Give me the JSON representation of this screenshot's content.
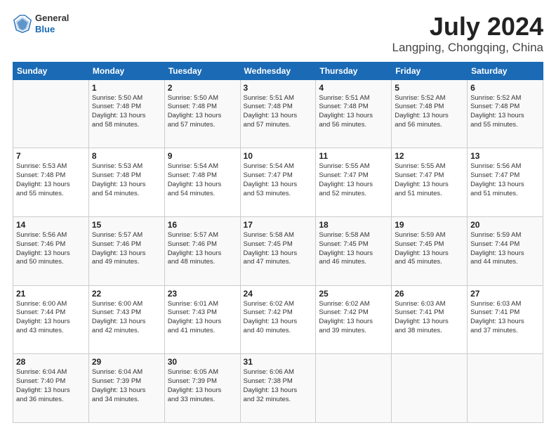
{
  "header": {
    "logo_line1": "General",
    "logo_line2": "Blue",
    "month": "July 2024",
    "location": "Langping, Chongqing, China"
  },
  "days_of_week": [
    "Sunday",
    "Monday",
    "Tuesday",
    "Wednesday",
    "Thursday",
    "Friday",
    "Saturday"
  ],
  "weeks": [
    [
      {
        "day": "",
        "content": ""
      },
      {
        "day": "1",
        "content": "Sunrise: 5:50 AM\nSunset: 7:48 PM\nDaylight: 13 hours\nand 58 minutes."
      },
      {
        "day": "2",
        "content": "Sunrise: 5:50 AM\nSunset: 7:48 PM\nDaylight: 13 hours\nand 57 minutes."
      },
      {
        "day": "3",
        "content": "Sunrise: 5:51 AM\nSunset: 7:48 PM\nDaylight: 13 hours\nand 57 minutes."
      },
      {
        "day": "4",
        "content": "Sunrise: 5:51 AM\nSunset: 7:48 PM\nDaylight: 13 hours\nand 56 minutes."
      },
      {
        "day": "5",
        "content": "Sunrise: 5:52 AM\nSunset: 7:48 PM\nDaylight: 13 hours\nand 56 minutes."
      },
      {
        "day": "6",
        "content": "Sunrise: 5:52 AM\nSunset: 7:48 PM\nDaylight: 13 hours\nand 55 minutes."
      }
    ],
    [
      {
        "day": "7",
        "content": "Sunrise: 5:53 AM\nSunset: 7:48 PM\nDaylight: 13 hours\nand 55 minutes."
      },
      {
        "day": "8",
        "content": "Sunrise: 5:53 AM\nSunset: 7:48 PM\nDaylight: 13 hours\nand 54 minutes."
      },
      {
        "day": "9",
        "content": "Sunrise: 5:54 AM\nSunset: 7:48 PM\nDaylight: 13 hours\nand 54 minutes."
      },
      {
        "day": "10",
        "content": "Sunrise: 5:54 AM\nSunset: 7:47 PM\nDaylight: 13 hours\nand 53 minutes."
      },
      {
        "day": "11",
        "content": "Sunrise: 5:55 AM\nSunset: 7:47 PM\nDaylight: 13 hours\nand 52 minutes."
      },
      {
        "day": "12",
        "content": "Sunrise: 5:55 AM\nSunset: 7:47 PM\nDaylight: 13 hours\nand 51 minutes."
      },
      {
        "day": "13",
        "content": "Sunrise: 5:56 AM\nSunset: 7:47 PM\nDaylight: 13 hours\nand 51 minutes."
      }
    ],
    [
      {
        "day": "14",
        "content": "Sunrise: 5:56 AM\nSunset: 7:46 PM\nDaylight: 13 hours\nand 50 minutes."
      },
      {
        "day": "15",
        "content": "Sunrise: 5:57 AM\nSunset: 7:46 PM\nDaylight: 13 hours\nand 49 minutes."
      },
      {
        "day": "16",
        "content": "Sunrise: 5:57 AM\nSunset: 7:46 PM\nDaylight: 13 hours\nand 48 minutes."
      },
      {
        "day": "17",
        "content": "Sunrise: 5:58 AM\nSunset: 7:45 PM\nDaylight: 13 hours\nand 47 minutes."
      },
      {
        "day": "18",
        "content": "Sunrise: 5:58 AM\nSunset: 7:45 PM\nDaylight: 13 hours\nand 46 minutes."
      },
      {
        "day": "19",
        "content": "Sunrise: 5:59 AM\nSunset: 7:45 PM\nDaylight: 13 hours\nand 45 minutes."
      },
      {
        "day": "20",
        "content": "Sunrise: 5:59 AM\nSunset: 7:44 PM\nDaylight: 13 hours\nand 44 minutes."
      }
    ],
    [
      {
        "day": "21",
        "content": "Sunrise: 6:00 AM\nSunset: 7:44 PM\nDaylight: 13 hours\nand 43 minutes."
      },
      {
        "day": "22",
        "content": "Sunrise: 6:00 AM\nSunset: 7:43 PM\nDaylight: 13 hours\nand 42 minutes."
      },
      {
        "day": "23",
        "content": "Sunrise: 6:01 AM\nSunset: 7:43 PM\nDaylight: 13 hours\nand 41 minutes."
      },
      {
        "day": "24",
        "content": "Sunrise: 6:02 AM\nSunset: 7:42 PM\nDaylight: 13 hours\nand 40 minutes."
      },
      {
        "day": "25",
        "content": "Sunrise: 6:02 AM\nSunset: 7:42 PM\nDaylight: 13 hours\nand 39 minutes."
      },
      {
        "day": "26",
        "content": "Sunrise: 6:03 AM\nSunset: 7:41 PM\nDaylight: 13 hours\nand 38 minutes."
      },
      {
        "day": "27",
        "content": "Sunrise: 6:03 AM\nSunset: 7:41 PM\nDaylight: 13 hours\nand 37 minutes."
      }
    ],
    [
      {
        "day": "28",
        "content": "Sunrise: 6:04 AM\nSunset: 7:40 PM\nDaylight: 13 hours\nand 36 minutes."
      },
      {
        "day": "29",
        "content": "Sunrise: 6:04 AM\nSunset: 7:39 PM\nDaylight: 13 hours\nand 34 minutes."
      },
      {
        "day": "30",
        "content": "Sunrise: 6:05 AM\nSunset: 7:39 PM\nDaylight: 13 hours\nand 33 minutes."
      },
      {
        "day": "31",
        "content": "Sunrise: 6:06 AM\nSunset: 7:38 PM\nDaylight: 13 hours\nand 32 minutes."
      },
      {
        "day": "",
        "content": ""
      },
      {
        "day": "",
        "content": ""
      },
      {
        "day": "",
        "content": ""
      }
    ]
  ]
}
